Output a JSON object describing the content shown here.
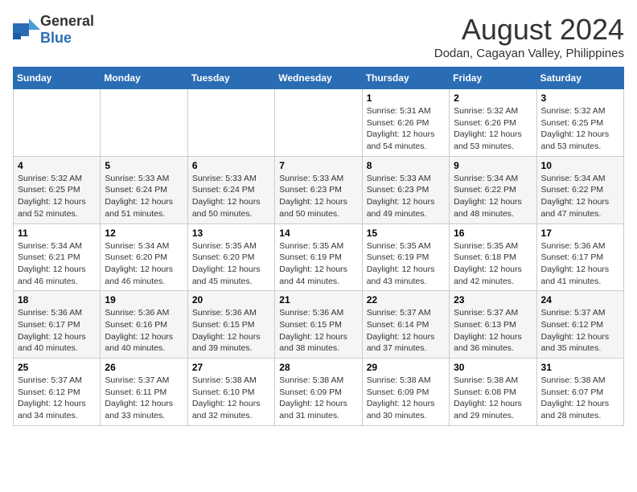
{
  "logo": {
    "general": "General",
    "blue": "Blue"
  },
  "title": {
    "month_year": "August 2024",
    "location": "Dodan, Cagayan Valley, Philippines"
  },
  "days_of_week": [
    "Sunday",
    "Monday",
    "Tuesday",
    "Wednesday",
    "Thursday",
    "Friday",
    "Saturday"
  ],
  "weeks": [
    [
      {
        "day": "",
        "info": ""
      },
      {
        "day": "",
        "info": ""
      },
      {
        "day": "",
        "info": ""
      },
      {
        "day": "",
        "info": ""
      },
      {
        "day": "1",
        "info": "Sunrise: 5:31 AM\nSunset: 6:26 PM\nDaylight: 12 hours\nand 54 minutes."
      },
      {
        "day": "2",
        "info": "Sunrise: 5:32 AM\nSunset: 6:26 PM\nDaylight: 12 hours\nand 53 minutes."
      },
      {
        "day": "3",
        "info": "Sunrise: 5:32 AM\nSunset: 6:25 PM\nDaylight: 12 hours\nand 53 minutes."
      }
    ],
    [
      {
        "day": "4",
        "info": "Sunrise: 5:32 AM\nSunset: 6:25 PM\nDaylight: 12 hours\nand 52 minutes."
      },
      {
        "day": "5",
        "info": "Sunrise: 5:33 AM\nSunset: 6:24 PM\nDaylight: 12 hours\nand 51 minutes."
      },
      {
        "day": "6",
        "info": "Sunrise: 5:33 AM\nSunset: 6:24 PM\nDaylight: 12 hours\nand 50 minutes."
      },
      {
        "day": "7",
        "info": "Sunrise: 5:33 AM\nSunset: 6:23 PM\nDaylight: 12 hours\nand 50 minutes."
      },
      {
        "day": "8",
        "info": "Sunrise: 5:33 AM\nSunset: 6:23 PM\nDaylight: 12 hours\nand 49 minutes."
      },
      {
        "day": "9",
        "info": "Sunrise: 5:34 AM\nSunset: 6:22 PM\nDaylight: 12 hours\nand 48 minutes."
      },
      {
        "day": "10",
        "info": "Sunrise: 5:34 AM\nSunset: 6:22 PM\nDaylight: 12 hours\nand 47 minutes."
      }
    ],
    [
      {
        "day": "11",
        "info": "Sunrise: 5:34 AM\nSunset: 6:21 PM\nDaylight: 12 hours\nand 46 minutes."
      },
      {
        "day": "12",
        "info": "Sunrise: 5:34 AM\nSunset: 6:20 PM\nDaylight: 12 hours\nand 46 minutes."
      },
      {
        "day": "13",
        "info": "Sunrise: 5:35 AM\nSunset: 6:20 PM\nDaylight: 12 hours\nand 45 minutes."
      },
      {
        "day": "14",
        "info": "Sunrise: 5:35 AM\nSunset: 6:19 PM\nDaylight: 12 hours\nand 44 minutes."
      },
      {
        "day": "15",
        "info": "Sunrise: 5:35 AM\nSunset: 6:19 PM\nDaylight: 12 hours\nand 43 minutes."
      },
      {
        "day": "16",
        "info": "Sunrise: 5:35 AM\nSunset: 6:18 PM\nDaylight: 12 hours\nand 42 minutes."
      },
      {
        "day": "17",
        "info": "Sunrise: 5:36 AM\nSunset: 6:17 PM\nDaylight: 12 hours\nand 41 minutes."
      }
    ],
    [
      {
        "day": "18",
        "info": "Sunrise: 5:36 AM\nSunset: 6:17 PM\nDaylight: 12 hours\nand 40 minutes."
      },
      {
        "day": "19",
        "info": "Sunrise: 5:36 AM\nSunset: 6:16 PM\nDaylight: 12 hours\nand 40 minutes."
      },
      {
        "day": "20",
        "info": "Sunrise: 5:36 AM\nSunset: 6:15 PM\nDaylight: 12 hours\nand 39 minutes."
      },
      {
        "day": "21",
        "info": "Sunrise: 5:36 AM\nSunset: 6:15 PM\nDaylight: 12 hours\nand 38 minutes."
      },
      {
        "day": "22",
        "info": "Sunrise: 5:37 AM\nSunset: 6:14 PM\nDaylight: 12 hours\nand 37 minutes."
      },
      {
        "day": "23",
        "info": "Sunrise: 5:37 AM\nSunset: 6:13 PM\nDaylight: 12 hours\nand 36 minutes."
      },
      {
        "day": "24",
        "info": "Sunrise: 5:37 AM\nSunset: 6:12 PM\nDaylight: 12 hours\nand 35 minutes."
      }
    ],
    [
      {
        "day": "25",
        "info": "Sunrise: 5:37 AM\nSunset: 6:12 PM\nDaylight: 12 hours\nand 34 minutes."
      },
      {
        "day": "26",
        "info": "Sunrise: 5:37 AM\nSunset: 6:11 PM\nDaylight: 12 hours\nand 33 minutes."
      },
      {
        "day": "27",
        "info": "Sunrise: 5:38 AM\nSunset: 6:10 PM\nDaylight: 12 hours\nand 32 minutes."
      },
      {
        "day": "28",
        "info": "Sunrise: 5:38 AM\nSunset: 6:09 PM\nDaylight: 12 hours\nand 31 minutes."
      },
      {
        "day": "29",
        "info": "Sunrise: 5:38 AM\nSunset: 6:09 PM\nDaylight: 12 hours\nand 30 minutes."
      },
      {
        "day": "30",
        "info": "Sunrise: 5:38 AM\nSunset: 6:08 PM\nDaylight: 12 hours\nand 29 minutes."
      },
      {
        "day": "31",
        "info": "Sunrise: 5:38 AM\nSunset: 6:07 PM\nDaylight: 12 hours\nand 28 minutes."
      }
    ]
  ]
}
